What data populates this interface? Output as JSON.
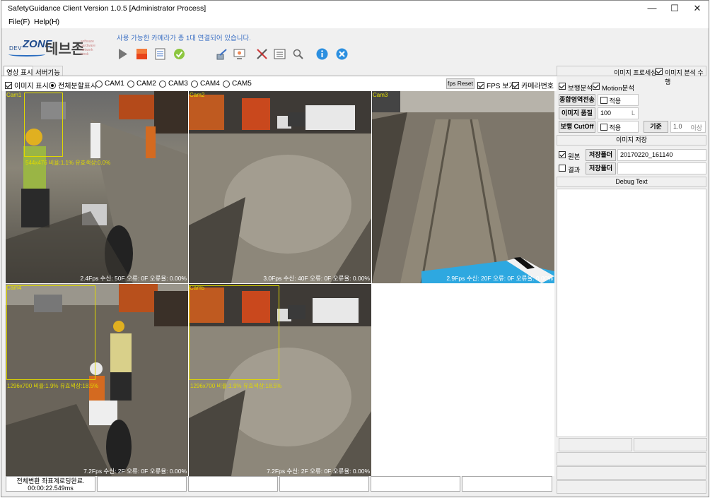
{
  "window": {
    "title": "SafetyGuidance Client Version 1.0.5 [Administrator Process]",
    "minimize": "—",
    "maximize": "☐",
    "close": "✕"
  },
  "menu": [
    "File(F)",
    "Help(H)"
  ],
  "branding": {
    "dev": "DEV",
    "zone": "ZONE",
    "korean": "데브존",
    "tagline": "software hardware network kiosk"
  },
  "status_message": "사용 가능한 카메라가 총 1대 연결되어 있습니다.",
  "toolbar_icons": [
    "play-icon",
    "stop-icon",
    "document-icon",
    "check-icon",
    "edit-tools-icon",
    "monitor-settings-icon",
    "tools-icon",
    "list-icon",
    "search-icon",
    "info-icon",
    "close-circle-icon"
  ],
  "tabs": [
    "영상 표시",
    "서버기능"
  ],
  "options": {
    "show_image": "이미지 표시",
    "show_all": "전체분할표시",
    "cams": [
      "CAM1",
      "CAM2",
      "CAM3",
      "CAM4",
      "CAM5"
    ],
    "fps_reset": "fps Reset",
    "fps_view": "FPS 보기",
    "camera_number": "카메라번호"
  },
  "cameras": [
    {
      "name": "Cam1",
      "stat": "2.4Fps   수신: 50F   오류: 0F   오류율: 0.00%",
      "roi_label": "544x476 비율:1.1% 유효색상:0.0%"
    },
    {
      "name": "Cam2",
      "stat": "3.0Fps   수신: 40F   오류: 0F   오류율: 0.00%",
      "roi_label": ""
    },
    {
      "name": "Cam3",
      "stat": "2.9Fps   수신: 20F   오류: 0F   오류율: 0.00%",
      "roi_label": ""
    },
    {
      "name": "Cam4",
      "stat": "7.2Fps   수신: 2F   오류: 0F   오류율: 0.00%",
      "roi_label": "1296x700 비율:1.9% 유효색상:18.5%"
    },
    {
      "name": "Cam5",
      "stat": "7.2Fps   수신: 2F   오류: 0F   오류율: 0.00%",
      "roi_label": "1296x700 비율:1.9% 유효색상:18.5%"
    }
  ],
  "status_cells": [
    {
      "line1": "전체변환 좌표계로딩완료.",
      "line2": "00:00:22.549ms"
    },
    {
      "line1": "",
      "line2": ""
    },
    {
      "line1": "",
      "line2": ""
    },
    {
      "line1": "",
      "line2": ""
    },
    {
      "line1": "",
      "line2": ""
    },
    {
      "line1": "",
      "line2": ""
    }
  ],
  "right_panel": {
    "image_processing": "이미지 프로세싱",
    "run_analysis": "이미지 분석 수행",
    "walk_analysis": "보행분석",
    "motion_analysis": "Motion분석",
    "region_transfer": "종합영역전송",
    "apply1": "적용",
    "image_quality": "이미지 품질",
    "quality_value": "100",
    "quality_unit": "L",
    "walk_cutoff": "보행 CutOff",
    "apply2": "적용",
    "standard": "기준",
    "standard_value": "1.0",
    "above": "이상",
    "image_save": "이미지 저장",
    "original": "원본",
    "save_folder1": "저장폴더",
    "folder_value": "20170220_161140",
    "result": "결과",
    "save_folder2": "저장폴더",
    "debug_text": "Debug Text"
  }
}
